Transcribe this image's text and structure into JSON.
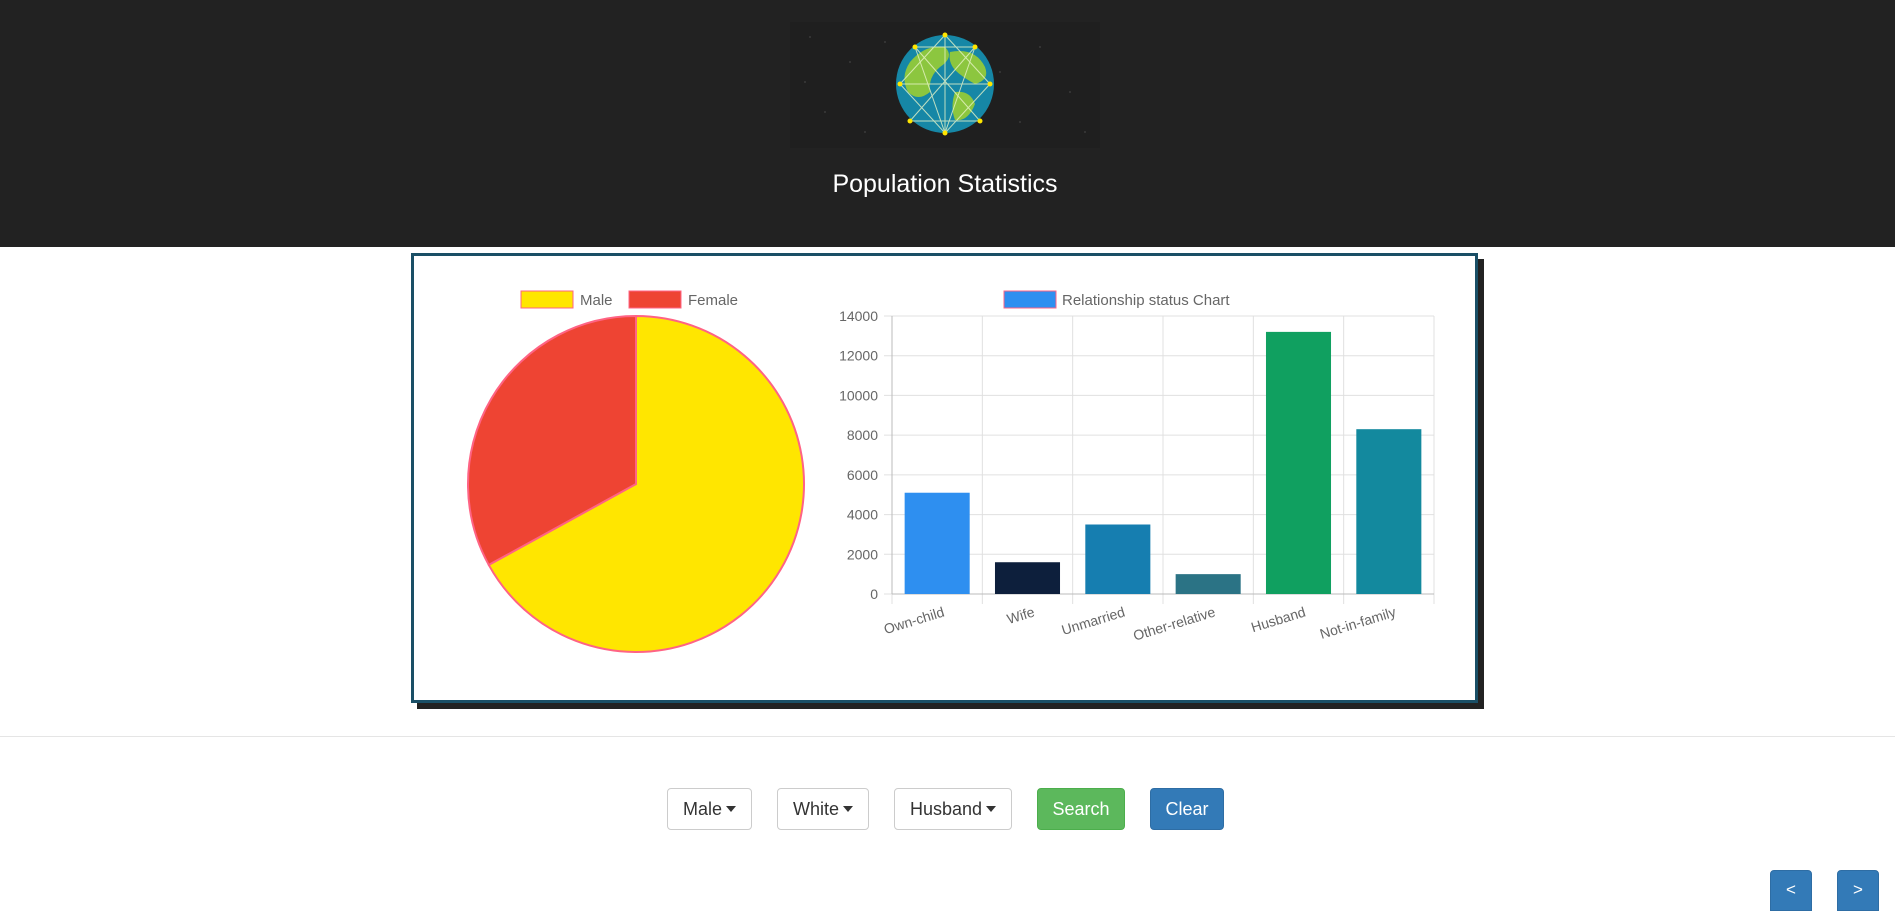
{
  "header": {
    "title": "Population Statistics",
    "logo_icon": "globe-network-icon"
  },
  "chart_data": [
    {
      "type": "pie",
      "categories": [
        "Male",
        "Female"
      ],
      "values": [
        0.67,
        0.33
      ],
      "colors": [
        "#ffe600",
        "#ee4433"
      ],
      "border_color": "#ff6384",
      "legend_position": "top"
    },
    {
      "type": "bar",
      "categories": [
        "Own-child",
        "Wife",
        "Unmarried",
        "Other-relative",
        "Husband",
        "Not-in-family"
      ],
      "series": [
        {
          "name": "Relationship status Chart",
          "values": [
            5100,
            1600,
            3500,
            1000,
            13200,
            8300
          ]
        }
      ],
      "colors": [
        "#2e8ff0",
        "#0d1f3c",
        "#167eb0",
        "#2b7385",
        "#10a060",
        "#13899e"
      ],
      "legend_color": "#2e8ff0",
      "legend_border": "#ff6384",
      "ylim": [
        0,
        14000
      ],
      "yticks": [
        "0",
        "2000",
        "4000",
        "6000",
        "8000",
        "10000",
        "12000",
        "14000"
      ],
      "grid": true,
      "legend_position": "top"
    }
  ],
  "filters": {
    "sex": "Male",
    "race": "White",
    "relationship": "Husband"
  },
  "buttons": {
    "search": "Search",
    "clear": "Clear",
    "prev": "<",
    "next": ">"
  }
}
